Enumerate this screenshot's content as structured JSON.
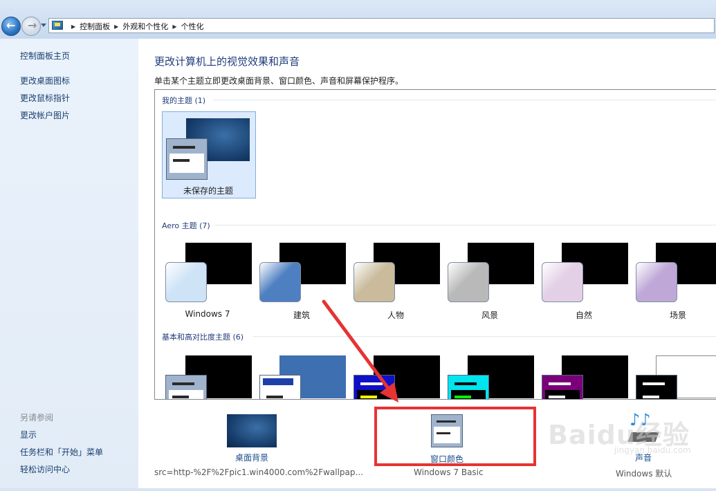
{
  "breadcrumb": [
    "控制面板",
    "外观和个性化",
    "个性化"
  ],
  "sidebar": {
    "home": "控制面板主页",
    "links": [
      "更改桌面图标",
      "更改鼠标指针",
      "更改帐户图片"
    ],
    "see_also_title": "另请参阅",
    "see_also": [
      "显示",
      "任务栏和「开始」菜单",
      "轻松访问中心"
    ]
  },
  "main": {
    "title": "更改计算机上的视觉效果和声音",
    "subtitle": "单击某个主题立即更改桌面背景、窗口颜色、声音和屏幕保护程序。",
    "groups": [
      {
        "header": "我的主题 (1)",
        "themes": [
          {
            "name": "未保存的主题",
            "selected": true
          }
        ]
      },
      {
        "header": "Aero 主题 (7)",
        "themes": [
          {
            "name": "Windows 7",
            "tint": "#cfe3f7"
          },
          {
            "name": "建筑",
            "tint": "#4e7fc0"
          },
          {
            "name": "人物",
            "tint": "#c9bb9c"
          },
          {
            "name": "风景",
            "tint": "#b9b9b9"
          },
          {
            "name": "自然",
            "tint": "#e3d0e6"
          },
          {
            "name": "场景",
            "tint": "#bfa8d8"
          }
        ]
      },
      {
        "header": "基本和高对比度主题 (6)",
        "themes": [
          {
            "frame": "#9fb3cc",
            "bar": "#ffffff"
          },
          {
            "frame": "#ffffff",
            "bar": "#1e3fa8"
          },
          {
            "frame": "#1010c8",
            "bar": "#ffff00"
          },
          {
            "frame": "#00e5ee",
            "bar": "#00ff00"
          },
          {
            "frame": "#7a007a",
            "bar": "#ffffff"
          },
          {
            "frame": "#000000",
            "bar": "#ffffff"
          }
        ]
      }
    ]
  },
  "bottom": {
    "desktop_background": {
      "label": "桌面背景",
      "sub": "src=http-%2F%2Fpic1.win4000.com%2Fwallpap..."
    },
    "window_color": {
      "label": "窗口颜色",
      "sub": "Windows 7 Basic"
    },
    "sounds": {
      "label": "声音",
      "sub": "Windows 默认"
    }
  },
  "watermark": {
    "brand": "Baidu经验",
    "url": "jingyan.baidu.com"
  },
  "colors": {
    "annotation_red": "#e63333",
    "link_blue": "#1a4e8c"
  }
}
